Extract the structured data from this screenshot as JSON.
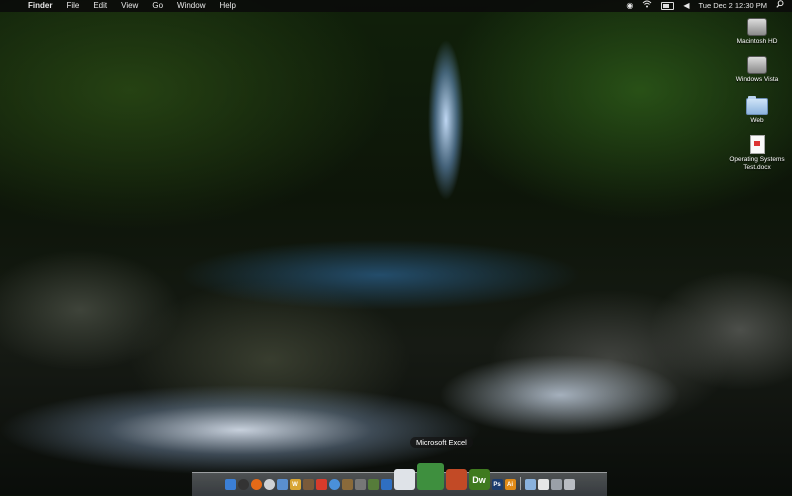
{
  "menubar": {
    "apple_glyph": "",
    "app_name": "Finder",
    "menus": [
      "File",
      "Edit",
      "View",
      "Go",
      "Window",
      "Help"
    ],
    "tray_icons": [
      "spotlight-status-icon",
      "wifi-icon",
      "battery-icon",
      "volume-icon"
    ],
    "clock": "Tue Dec 2  12:30 PM",
    "search_icon": "search-icon"
  },
  "desktop": {
    "icons": [
      {
        "label": "Macintosh HD",
        "icon": "hard-drive-icon"
      },
      {
        "label": "Windows Vista",
        "icon": "hard-drive-icon"
      },
      {
        "label": "Web",
        "icon": "folder-icon"
      },
      {
        "label": "Operating Systems Test.docx",
        "icon": "document-icon"
      }
    ]
  },
  "dock": {
    "tooltip": "Microsoft Excel",
    "apps": [
      {
        "name": "finder",
        "icon": "finder-icon",
        "color": "#3b7fd6",
        "glyph": ""
      },
      {
        "name": "dashboard",
        "icon": "dashboard-icon",
        "color": "#333333",
        "glyph": ""
      },
      {
        "name": "firefox",
        "icon": "firefox-icon",
        "color": "#e56a17",
        "glyph": ""
      },
      {
        "name": "itunes-cd",
        "icon": "cd-icon",
        "color": "#cfd2d6",
        "glyph": ""
      },
      {
        "name": "mail",
        "icon": "mail-icon",
        "color": "#5a8fcf",
        "glyph": ""
      },
      {
        "name": "word",
        "icon": "word-icon",
        "color": "#d8a533",
        "glyph": "W"
      },
      {
        "name": "address-book",
        "icon": "address-book-icon",
        "color": "#7a5a3a",
        "glyph": ""
      },
      {
        "name": "ical",
        "icon": "calendar-icon",
        "color": "#d83b2b",
        "glyph": ""
      },
      {
        "name": "safari",
        "icon": "safari-icon",
        "color": "#4a90d9",
        "glyph": ""
      },
      {
        "name": "iphoto",
        "icon": "photo-icon",
        "color": "#8a6a3a",
        "glyph": ""
      },
      {
        "name": "utilities",
        "icon": "tools-icon",
        "color": "#777777",
        "glyph": ""
      },
      {
        "name": "preview",
        "icon": "preview-icon",
        "color": "#567c3a",
        "glyph": ""
      },
      {
        "name": "app-store",
        "icon": "app-store-icon",
        "color": "#2f6fc1",
        "glyph": ""
      },
      {
        "name": "documents",
        "icon": "documents-icon",
        "color": "#dfe3e8",
        "glyph": "",
        "size": "mid"
      },
      {
        "name": "excel",
        "icon": "excel-icon",
        "color": "#3e8f3e",
        "glyph": "",
        "size": "big"
      },
      {
        "name": "powerpoint",
        "icon": "powerpoint-icon",
        "color": "#c24a26",
        "glyph": "",
        "size": "mid"
      },
      {
        "name": "dreamweaver",
        "icon": "dreamweaver-icon",
        "color": "#3f7a1f",
        "glyph": "Dw",
        "size": "mid"
      },
      {
        "name": "photoshop",
        "icon": "photoshop-icon",
        "color": "#1c3c6e",
        "glyph": "Ps"
      },
      {
        "name": "illustrator",
        "icon": "illustrator-icon",
        "color": "#e08a16",
        "glyph": "Ai"
      }
    ],
    "stacks": [
      {
        "name": "applications",
        "icon": "applications-folder-icon",
        "color": "#8ab2dd",
        "glyph": ""
      },
      {
        "name": "documents-stack",
        "icon": "documents-stack-icon",
        "color": "#e6e6e6",
        "glyph": ""
      },
      {
        "name": "downloads",
        "icon": "downloads-icon",
        "color": "#9aa0a8",
        "glyph": ""
      },
      {
        "name": "trash",
        "icon": "trash-icon",
        "color": "#b9bdc3",
        "glyph": ""
      }
    ]
  }
}
